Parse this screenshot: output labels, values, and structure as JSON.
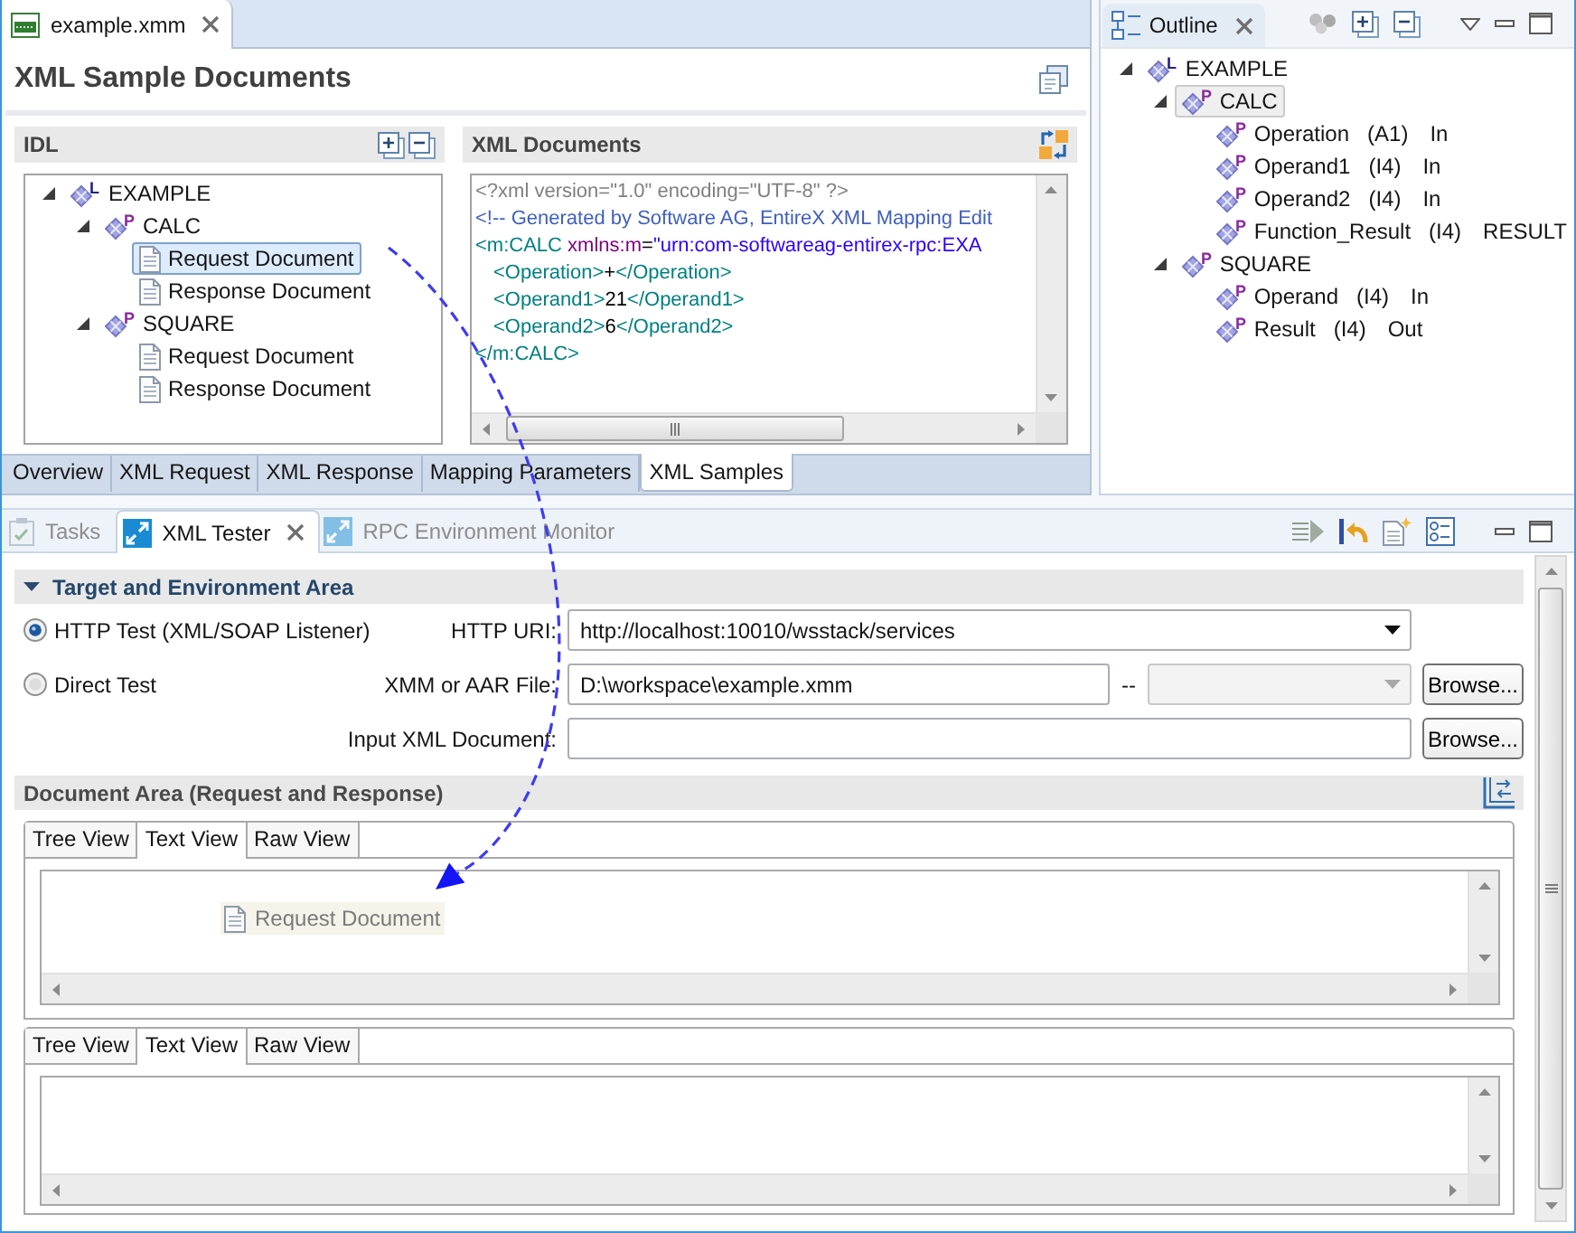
{
  "editor": {
    "tabs": [
      {
        "label": "example.xmm",
        "selected": true
      }
    ],
    "title": "XML Sample Documents",
    "idl": {
      "title": "IDL",
      "tree": [
        {
          "label": "EXAMPLE",
          "kind": "library",
          "badge": "L",
          "expanded": true,
          "selected": false,
          "children": [
            {
              "label": "CALC",
              "kind": "program",
              "badge": "P",
              "expanded": true,
              "selected": false,
              "children": [
                {
                  "label": "Request Document",
                  "kind": "document",
                  "selected": true
                },
                {
                  "label": "Response Document",
                  "kind": "document",
                  "selected": false
                }
              ]
            },
            {
              "label": "SQUARE",
              "kind": "program",
              "badge": "P",
              "expanded": true,
              "selected": false,
              "children": [
                {
                  "label": "Request Document",
                  "kind": "document",
                  "selected": false
                },
                {
                  "label": "Response Document",
                  "kind": "document",
                  "selected": false
                }
              ]
            }
          ]
        }
      ]
    },
    "xml_documents": {
      "title": "XML Documents",
      "lines": [
        {
          "tokens": [
            {
              "kind": "declaration",
              "text": "<?xml version=\"1.0\" encoding=\"UTF-8\" ?>"
            }
          ]
        },
        {
          "tokens": [
            {
              "kind": "comment",
              "text": "<!-- Generated by Software AG, EntireX XML Mapping Edit"
            }
          ]
        },
        {
          "tokens": [
            {
              "kind": "tag",
              "text": "<m:CALC"
            },
            {
              "kind": "attribute",
              "text": " xmlns:m"
            },
            {
              "kind": "text",
              "text": "="
            },
            {
              "kind": "string",
              "text": "\"urn:com-softwareag-entirex-rpc:EXA"
            }
          ],
          "children": [
            {
              "tokens": [
                {
                  "kind": "tag",
                  "text": "<Operation>"
                },
                {
                  "kind": "text",
                  "text": "+"
                },
                {
                  "kind": "tag",
                  "text": "</Operation>"
                }
              ]
            },
            {
              "tokens": [
                {
                  "kind": "tag",
                  "text": "<Operand1>"
                },
                {
                  "kind": "text",
                  "text": "21"
                },
                {
                  "kind": "tag",
                  "text": "</Operand1>"
                }
              ]
            },
            {
              "tokens": [
                {
                  "kind": "tag",
                  "text": "<Operand2>"
                },
                {
                  "kind": "text",
                  "text": "6"
                },
                {
                  "kind": "tag",
                  "text": "</Operand2>"
                }
              ]
            }
          ]
        },
        {
          "tokens": [
            {
              "kind": "tag",
              "text": "</m:CALC>"
            }
          ]
        }
      ]
    },
    "page_tabs": [
      {
        "label": "Overview",
        "selected": false
      },
      {
        "label": "XML Request",
        "selected": false
      },
      {
        "label": "XML Response",
        "selected": false
      },
      {
        "label": "Mapping Parameters",
        "selected": false
      },
      {
        "label": "XML Samples",
        "selected": true
      }
    ]
  },
  "outline": {
    "tab_label": "Outline",
    "tree": [
      {
        "label": "EXAMPLE",
        "kind": "library",
        "badge": "L",
        "expanded": true,
        "selected": false,
        "children": [
          {
            "label": "CALC",
            "kind": "program",
            "badge": "P",
            "expanded": true,
            "selected": true,
            "children": [
              {
                "label": "Operation",
                "type": "(A1)",
                "direction": "In",
                "kind": "parameter",
                "badge": "P",
                "selected": false
              },
              {
                "label": "Operand1",
                "type": "(I4)",
                "direction": "In",
                "kind": "parameter",
                "badge": "P",
                "selected": false
              },
              {
                "label": "Operand2",
                "type": "(I4)",
                "direction": "In",
                "kind": "parameter",
                "badge": "P",
                "selected": false
              },
              {
                "label": "Function_Result",
                "type": "(I4)",
                "direction": "RESULT",
                "kind": "parameter",
                "badge": "P",
                "selected": false
              }
            ]
          },
          {
            "label": "SQUARE",
            "kind": "program",
            "badge": "P",
            "expanded": true,
            "selected": false,
            "children": [
              {
                "label": "Operand",
                "type": "(I4)",
                "direction": "In",
                "kind": "parameter",
                "badge": "P",
                "selected": false
              },
              {
                "label": "Result",
                "type": "(I4)",
                "direction": "Out",
                "kind": "parameter",
                "badge": "P",
                "selected": false
              }
            ]
          }
        ]
      }
    ]
  },
  "tester": {
    "view_tabs": [
      {
        "label": "Tasks",
        "kind": "clipboard",
        "selected": false
      },
      {
        "label": "XML Tester",
        "kind": "arrows",
        "selected": true
      },
      {
        "label": "RPC Environment Monitor",
        "kind": "arrows",
        "selected": false
      }
    ],
    "target_area": {
      "title": "Target and Environment Area",
      "expanded": true,
      "modes": [
        {
          "label": "HTTP Test (XML/SOAP Listener)",
          "selected": true
        },
        {
          "label": "Direct Test",
          "selected": false
        }
      ],
      "http_uri": {
        "label": "HTTP URI:",
        "value": "http://localhost:10010/wsstack/services",
        "disabled": false
      },
      "xmm_file": {
        "label": "XMM or AAR File:",
        "value": "D:\\workspace\\example.xmm",
        "separator": "--",
        "type_combo": {
          "disabled": true
        },
        "browse": "Browse..."
      },
      "input_xml": {
        "label": "Input XML Document:",
        "browse": "Browse..."
      }
    },
    "document_area": {
      "title": "Document Area (Request and Response)",
      "panes": [
        {
          "tabs": [
            {
              "label": "Tree View",
              "selected": false
            },
            {
              "label": "Text View",
              "selected": true
            },
            {
              "label": "Raw View",
              "selected": false
            }
          ],
          "drag_item": "Request Document"
        },
        {
          "tabs": [
            {
              "label": "Tree View",
              "selected": false
            },
            {
              "label": "Text View",
              "selected": true
            },
            {
              "label": "Raw View",
              "selected": false
            }
          ]
        }
      ]
    }
  }
}
